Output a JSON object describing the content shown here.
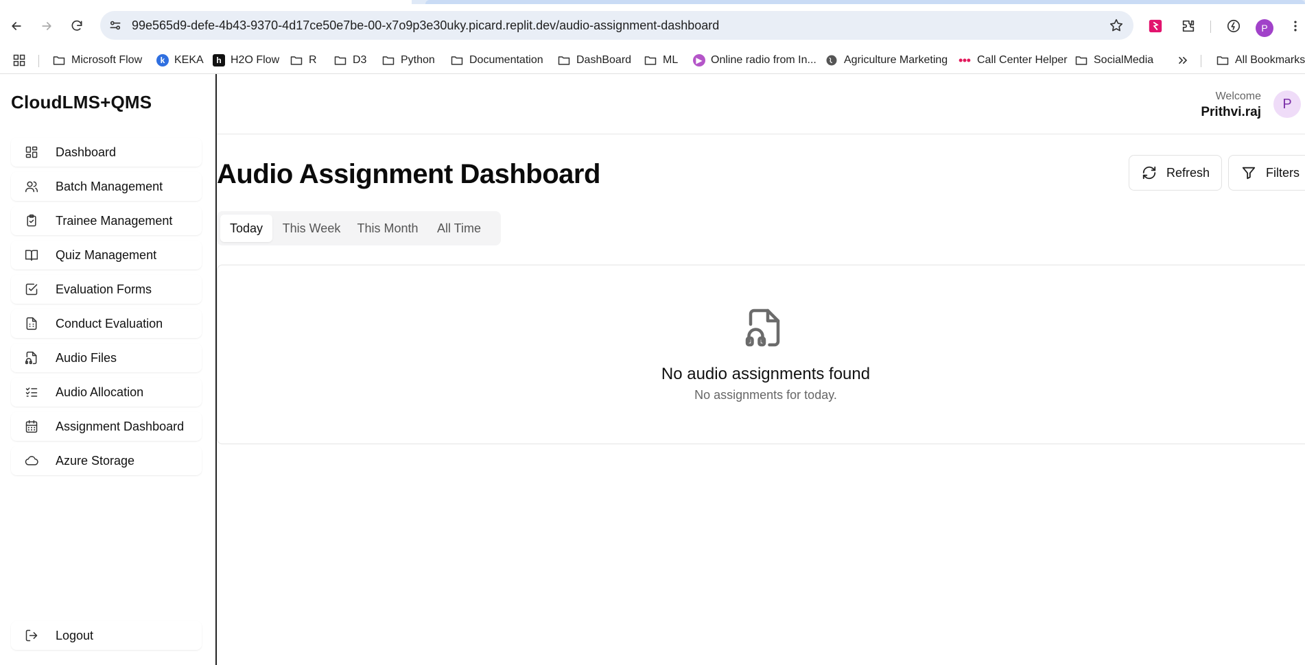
{
  "browser": {
    "url": "99e565d9-defe-4b43-9370-4d17ce50e7be-00-x7o9p3e30uky.picard.replit.dev/audio-assignment-dashboard",
    "profile_initial": "P",
    "bookmarks": [
      {
        "label": "Microsoft Flow",
        "icon": "folder-icon"
      },
      {
        "label": "KEKA",
        "icon": "keka-icon"
      },
      {
        "label": "H2O Flow",
        "icon": "h2o-icon"
      },
      {
        "label": "R",
        "icon": "folder-icon"
      },
      {
        "label": "D3",
        "icon": "folder-icon"
      },
      {
        "label": "Python",
        "icon": "folder-icon"
      },
      {
        "label": "Documentation",
        "icon": "folder-icon"
      },
      {
        "label": "DashBoard",
        "icon": "folder-icon"
      },
      {
        "label": "ML",
        "icon": "folder-icon"
      },
      {
        "label": "Online radio from In...",
        "icon": "radio-icon"
      },
      {
        "label": "Agriculture Marketing",
        "icon": "globe-icon"
      },
      {
        "label": "Call Center Helper",
        "icon": "dots-icon"
      },
      {
        "label": "SocialMedia",
        "icon": "folder-icon"
      },
      {
        "label": "All Bookmarks",
        "icon": "folder-icon"
      }
    ]
  },
  "app": {
    "brand": "CloudLMS+QMS",
    "nav": [
      {
        "label": "Dashboard",
        "icon": "grid-icon"
      },
      {
        "label": "Batch Management",
        "icon": "users-icon"
      },
      {
        "label": "Trainee Management",
        "icon": "clipboard-check-icon"
      },
      {
        "label": "Quiz Management",
        "icon": "book-open-icon"
      },
      {
        "label": "Evaluation Forms",
        "icon": "square-check-icon"
      },
      {
        "label": "Conduct Evaluation",
        "icon": "file-spreadsheet-icon"
      },
      {
        "label": "Audio Files",
        "icon": "file-audio-icon"
      },
      {
        "label": "Audio Allocation",
        "icon": "list-checks-icon"
      },
      {
        "label": "Assignment Dashboard",
        "icon": "calendar-icon"
      },
      {
        "label": "Azure Storage",
        "icon": "cloud-icon"
      }
    ],
    "logout": "Logout",
    "header": {
      "welcome": "Welcome",
      "user": "Prithvi.raj",
      "avatar_initial": "P"
    },
    "page_title": "Audio Assignment Dashboard",
    "actions": {
      "refresh": "Refresh",
      "filters": "Filters"
    },
    "tabs": [
      {
        "label": "Today",
        "active": true
      },
      {
        "label": "This Week",
        "active": false
      },
      {
        "label": "This Month",
        "active": false
      },
      {
        "label": "All Time",
        "active": false
      }
    ],
    "empty_state": {
      "icon": "file-audio-icon",
      "title": "No audio assignments found",
      "subtitle": "No assignments for today."
    }
  }
}
